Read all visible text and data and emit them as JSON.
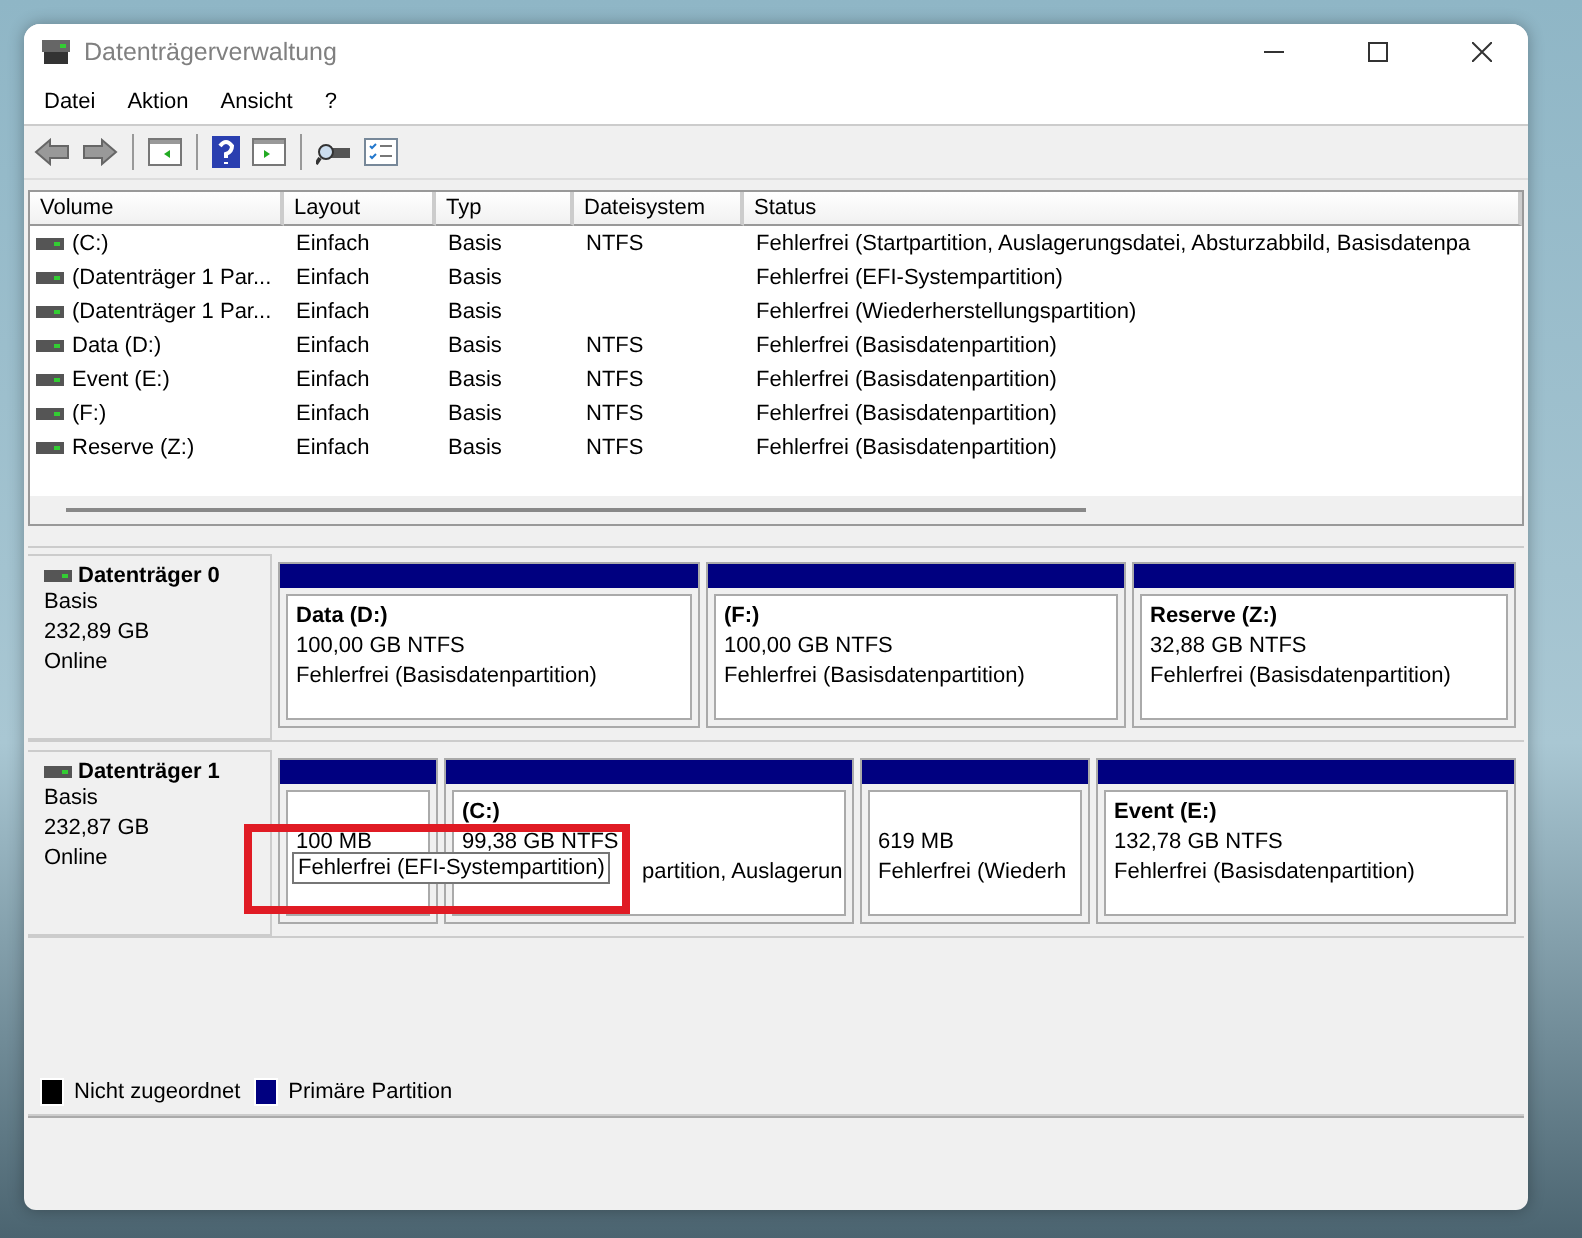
{
  "window": {
    "title": "Datenträgerverwaltung"
  },
  "menu": [
    "Datei",
    "Aktion",
    "Ansicht",
    "?"
  ],
  "table": {
    "columns": [
      "Volume",
      "Layout",
      "Typ",
      "Dateisystem",
      "Status"
    ],
    "rows": [
      [
        "(C:)",
        "Einfach",
        "Basis",
        "NTFS",
        "Fehlerfrei (Startpartition, Auslagerungsdatei, Absturzabbild, Basisdatenpa"
      ],
      [
        "(Datenträger 1 Par...",
        "Einfach",
        "Basis",
        "",
        "Fehlerfrei (EFI-Systempartition)"
      ],
      [
        "(Datenträger 1 Par...",
        "Einfach",
        "Basis",
        "",
        "Fehlerfrei (Wiederherstellungspartition)"
      ],
      [
        "Data (D:)",
        "Einfach",
        "Basis",
        "NTFS",
        "Fehlerfrei (Basisdatenpartition)"
      ],
      [
        "Event (E:)",
        "Einfach",
        "Basis",
        "NTFS",
        "Fehlerfrei (Basisdatenpartition)"
      ],
      [
        "(F:)",
        "Einfach",
        "Basis",
        "NTFS",
        "Fehlerfrei (Basisdatenpartition)"
      ],
      [
        "Reserve (Z:)",
        "Einfach",
        "Basis",
        "NTFS",
        "Fehlerfrei (Basisdatenpartition)"
      ]
    ]
  },
  "disks": [
    {
      "name": "Datenträger 0",
      "type": "Basis",
      "size": "232,89 GB",
      "state": "Online",
      "partitions": [
        {
          "name": "Data  (D:)",
          "size": "100,00 GB NTFS",
          "status": "Fehlerfrei (Basisdatenpartition)"
        },
        {
          "name": "(F:)",
          "size": "100,00 GB NTFS",
          "status": "Fehlerfrei (Basisdatenpartition)"
        },
        {
          "name": "Reserve  (Z:)",
          "size": "32,88 GB NTFS",
          "status": "Fehlerfrei (Basisdatenpartition)"
        }
      ]
    },
    {
      "name": "Datenträger 1",
      "type": "Basis",
      "size": "232,87 GB",
      "state": "Online",
      "partitions": [
        {
          "size": "100 MB",
          "tooltip": "Fehlerfrei (EFI-Systempartition)"
        },
        {
          "name": "(C:)",
          "size": "99,38 GB NTFS",
          "status": "partition, Auslagerun",
          "partly_covered": true
        },
        {
          "size": "619 MB",
          "status": "Fehlerfrei (Wiederh"
        },
        {
          "name": "Event  (E:)",
          "size": "132,78 GB NTFS",
          "status": "Fehlerfrei (Basisdatenpartition)"
        }
      ]
    }
  ],
  "legend": [
    {
      "label": "Nicht zugeordnet",
      "color": "#000000"
    },
    {
      "label": "Primäre Partition",
      "color": "#000080"
    }
  ]
}
